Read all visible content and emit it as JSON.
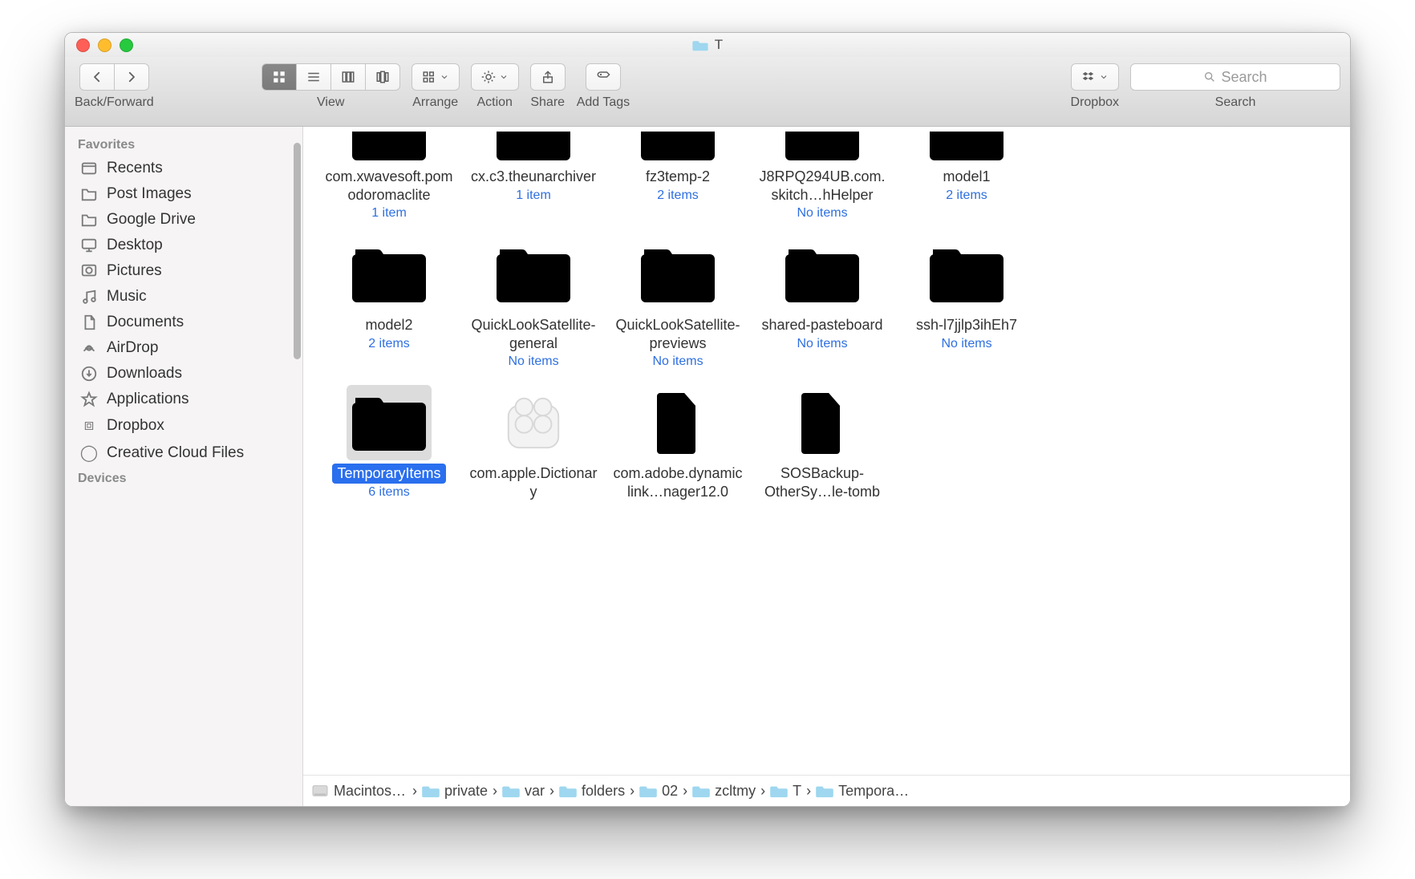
{
  "window": {
    "title": "T"
  },
  "toolbar": {
    "back_forward_label": "Back/Forward",
    "view_label": "View",
    "arrange_label": "Arrange",
    "action_label": "Action",
    "share_label": "Share",
    "add_tags_label": "Add Tags",
    "dropbox_label": "Dropbox",
    "search_label": "Search",
    "search_placeholder": "Search"
  },
  "sidebar": {
    "sections": [
      {
        "heading": "Favorites",
        "items": [
          {
            "label": "Recents",
            "icon": "recents"
          },
          {
            "label": "Post Images",
            "icon": "folder"
          },
          {
            "label": "Google Drive",
            "icon": "folder"
          },
          {
            "label": "Desktop",
            "icon": "desktop"
          },
          {
            "label": "Pictures",
            "icon": "pictures"
          },
          {
            "label": "Music",
            "icon": "music"
          },
          {
            "label": "Documents",
            "icon": "documents"
          },
          {
            "label": "AirDrop",
            "icon": "airdrop"
          },
          {
            "label": "Downloads",
            "icon": "downloads"
          },
          {
            "label": "Applications",
            "icon": "applications"
          },
          {
            "label": "Dropbox",
            "icon": "dropbox"
          },
          {
            "label": "Creative Cloud Files",
            "icon": "cc"
          }
        ]
      },
      {
        "heading": "Devices",
        "items": []
      }
    ]
  },
  "items": [
    {
      "name": "com.xwavesoft.pomodoromaclite",
      "sub": "1 item",
      "type": "folder",
      "partial": true
    },
    {
      "name": "cx.c3.theunarchiver",
      "sub": "1 item",
      "type": "folder",
      "partial": true
    },
    {
      "name": "fz3temp-2",
      "sub": "2 items",
      "type": "folder",
      "partial": true
    },
    {
      "name": "J8RPQ294UB.com.skitch…hHelper",
      "sub": "No items",
      "type": "folder",
      "partial": true
    },
    {
      "name": "model1",
      "sub": "2 items",
      "type": "folder",
      "partial": true
    },
    {
      "name": "model2",
      "sub": "2 items",
      "type": "folder"
    },
    {
      "name": "QuickLookSatellite-general",
      "sub": "No items",
      "type": "folder"
    },
    {
      "name": "QuickLookSatellite-previews",
      "sub": "No items",
      "type": "folder"
    },
    {
      "name": "shared-pasteboard",
      "sub": "No items",
      "type": "folder"
    },
    {
      "name": "ssh-l7jjlp3ihEh7",
      "sub": "No items",
      "type": "folder"
    },
    {
      "name": "TemporaryItems",
      "sub": "6 items",
      "type": "folder",
      "selected": true
    },
    {
      "name": "com.apple.Dictionary",
      "sub": "",
      "type": "kext"
    },
    {
      "name": "com.adobe.dynamiclink…nager12.0",
      "sub": "",
      "type": "doc"
    },
    {
      "name": "SOSBackup-OtherSy…le-tomb",
      "sub": "",
      "type": "doc"
    }
  ],
  "path": [
    {
      "label": "Macintosh HD",
      "icon": "disk"
    },
    {
      "label": "private",
      "icon": "folder"
    },
    {
      "label": "var",
      "icon": "folder"
    },
    {
      "label": "folders",
      "icon": "folder"
    },
    {
      "label": "02",
      "icon": "folder"
    },
    {
      "label": "zcltmy",
      "icon": "folder"
    },
    {
      "label": "T",
      "icon": "folder"
    },
    {
      "label": "TemporaryItems",
      "icon": "folder"
    }
  ]
}
